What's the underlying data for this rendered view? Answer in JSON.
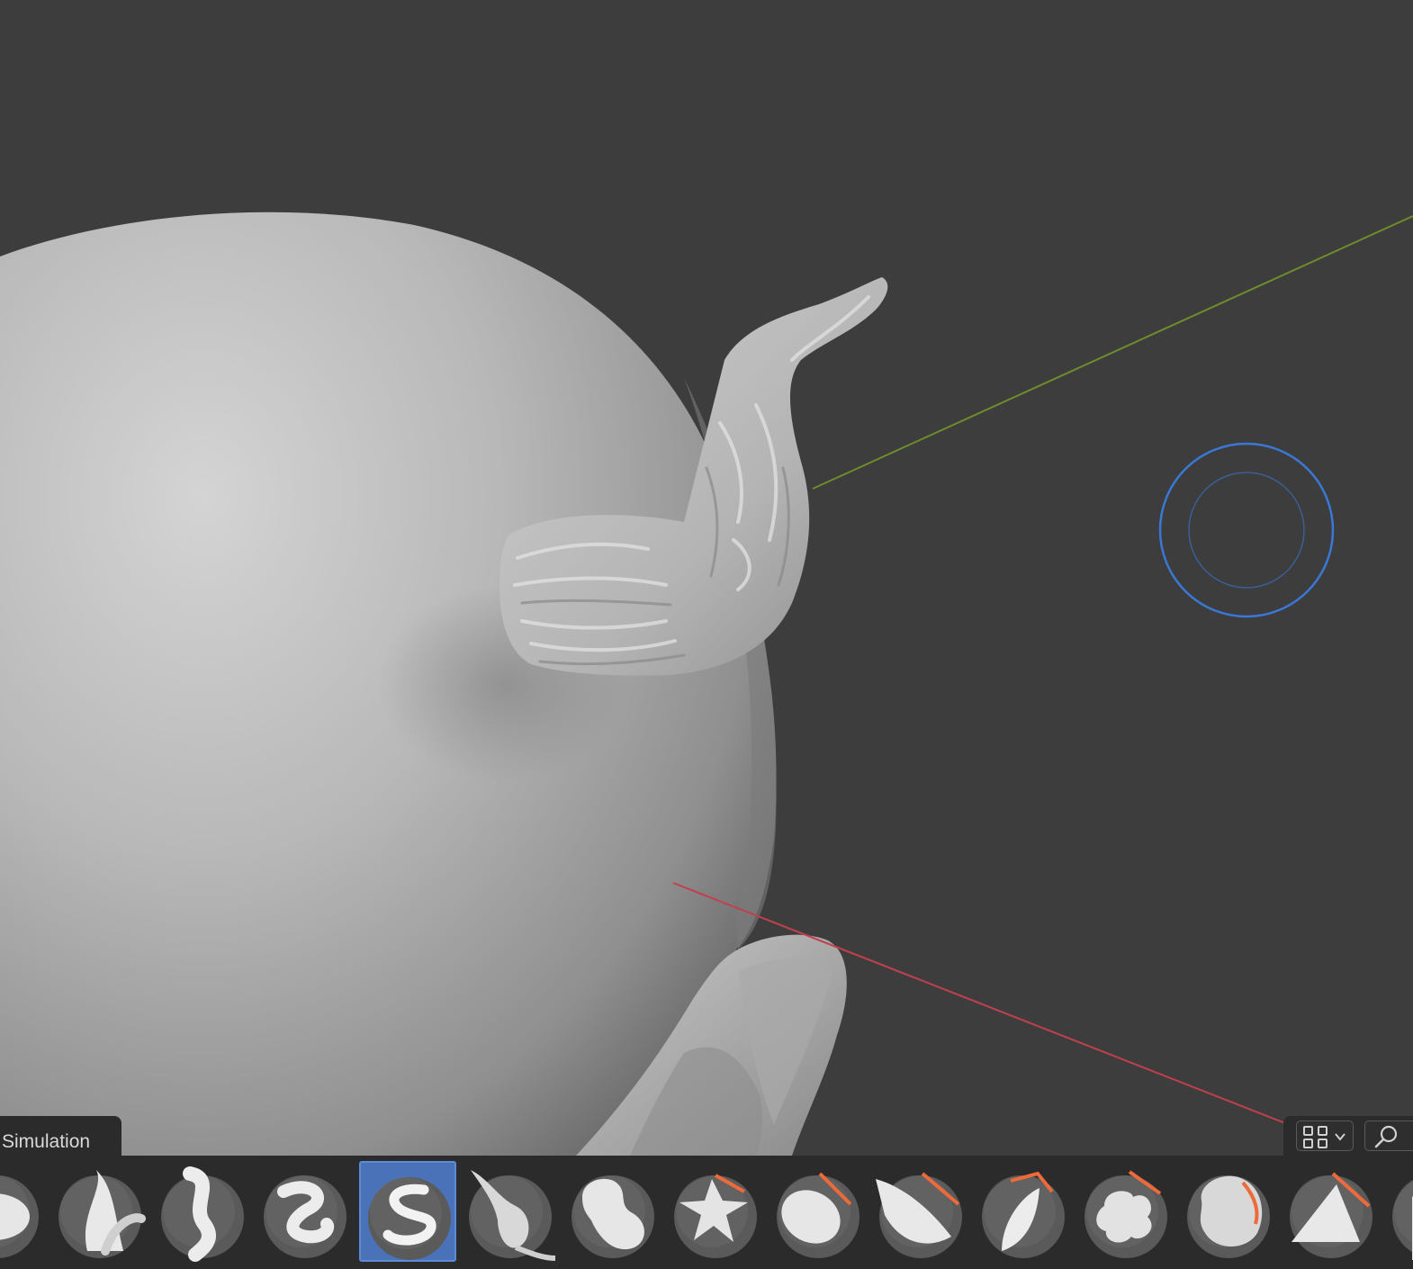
{
  "viewport": {
    "axis_x_color": "#c0404e",
    "axis_y_color": "#6e8c2c",
    "brush_cursor_color": "#3a78d6",
    "background_color": "#3d3d3d"
  },
  "simulation_tab": {
    "label": "Simulation"
  },
  "corner_tools": {
    "layout_icon": "grid-icon",
    "dropdown_icon": "chevron-down-icon",
    "search_icon": "search-icon"
  },
  "brush_bar": {
    "active_index": 4,
    "accent_color": "#4a72b8",
    "items": [
      {
        "icon": "brush-flatten-icon"
      },
      {
        "icon": "brush-smooth-stroke-icon"
      },
      {
        "icon": "brush-s-curve-icon"
      },
      {
        "icon": "brush-snake-curl-icon"
      },
      {
        "icon": "brush-snake-hook-icon"
      },
      {
        "icon": "brush-pull-tail-icon"
      },
      {
        "icon": "brush-inflate-blob-icon"
      },
      {
        "icon": "brush-cross-cut-icon"
      },
      {
        "icon": "brush-disc-slice-icon"
      },
      {
        "icon": "brush-wedge-icon"
      },
      {
        "icon": "brush-leaf-icon"
      },
      {
        "icon": "brush-cluster-icon"
      },
      {
        "icon": "brush-rough-blob-icon"
      },
      {
        "icon": "brush-cone-icon"
      },
      {
        "icon": "brush-partial-icon"
      }
    ]
  }
}
